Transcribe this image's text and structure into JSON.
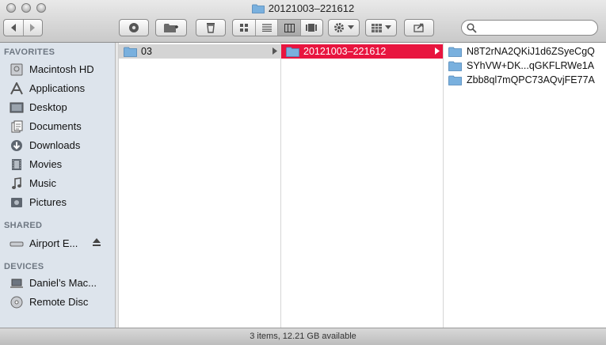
{
  "window": {
    "title": "20121003–221612"
  },
  "toolbar": {
    "back_icon": "back-arrow-icon",
    "forward_icon": "forward-arrow-icon",
    "view_modes": [
      "icon-view",
      "list-view",
      "column-view",
      "coverflow-view"
    ],
    "active_view": "column-view",
    "search_placeholder": ""
  },
  "sidebar": {
    "sections": [
      {
        "title": "FAVORITES",
        "items": [
          {
            "label": "Macintosh HD",
            "icon": "hard-drive-icon"
          },
          {
            "label": "Applications",
            "icon": "applications-icon"
          },
          {
            "label": "Desktop",
            "icon": "desktop-icon"
          },
          {
            "label": "Documents",
            "icon": "documents-icon"
          },
          {
            "label": "Downloads",
            "icon": "downloads-icon"
          },
          {
            "label": "Movies",
            "icon": "movies-icon"
          },
          {
            "label": "Music",
            "icon": "music-icon"
          },
          {
            "label": "Pictures",
            "icon": "pictures-icon"
          }
        ]
      },
      {
        "title": "SHARED",
        "items": [
          {
            "label": "Airport E...",
            "icon": "network-drive-icon"
          }
        ]
      },
      {
        "title": "DEVICES",
        "items": [
          {
            "label": "Daniel’s Mac...",
            "icon": "laptop-icon"
          },
          {
            "label": "Remote Disc",
            "icon": "disc-icon"
          }
        ]
      }
    ]
  },
  "columns": [
    {
      "items": [
        {
          "name": "03",
          "state": "parent"
        }
      ]
    },
    {
      "items": [
        {
          "name": "20121003–221612",
          "state": "selected"
        }
      ]
    },
    {
      "items": [
        {
          "name": "N8T2rNA2QKiJ1d6ZSyeCgQ"
        },
        {
          "name": "SYhVW+DK...qGKFLRWe1A"
        },
        {
          "name": "Zbb8ql7mQPC73AQvjFE77A"
        }
      ]
    }
  ],
  "status": {
    "text": "3 items, 12.21 GB available"
  },
  "colors": {
    "selection": "#e8153f",
    "sidebar_bg": "#dde4ec",
    "folder_blue": "#6aa6d8"
  }
}
